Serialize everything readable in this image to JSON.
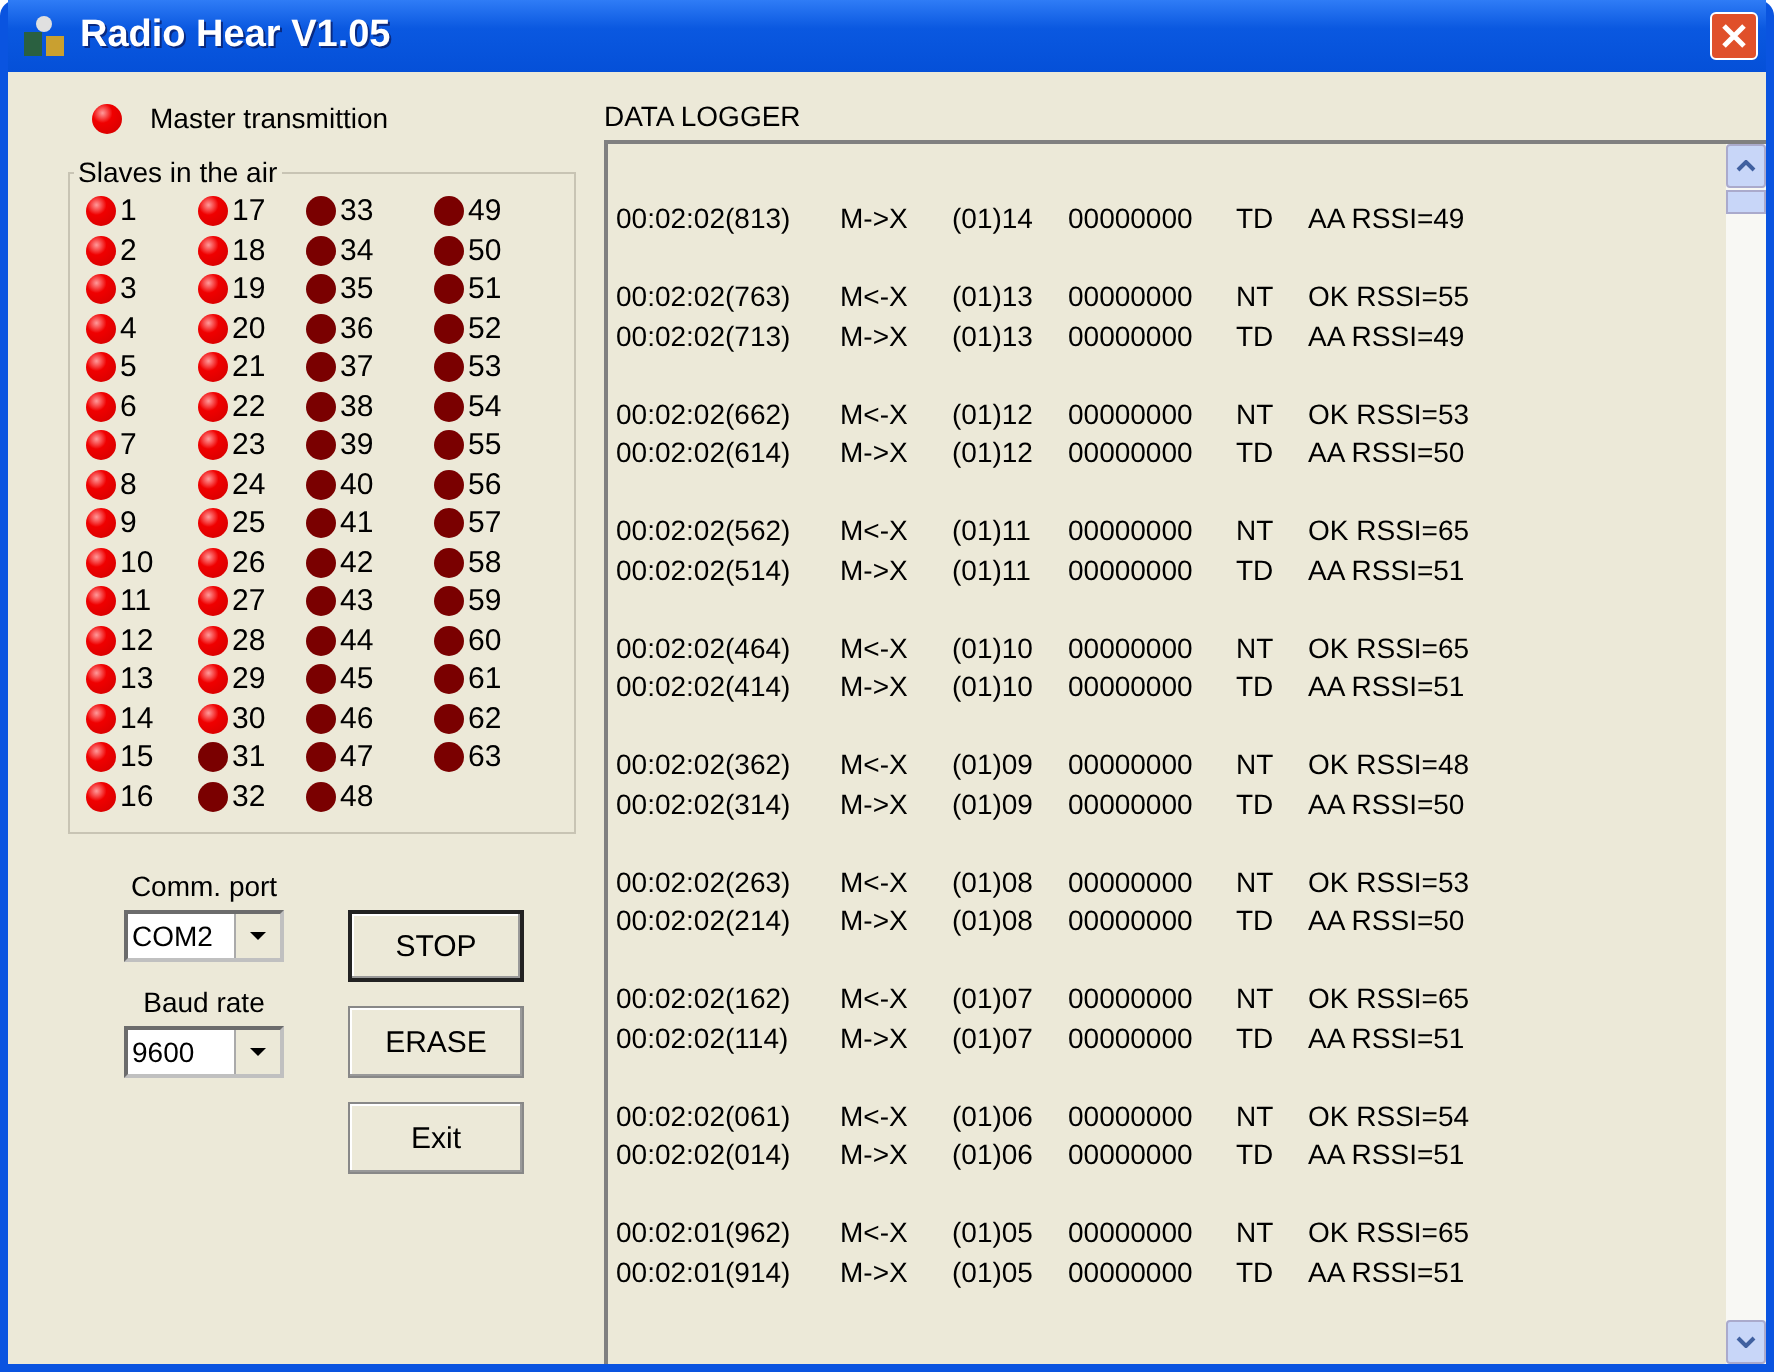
{
  "window": {
    "title": "Radio Hear V1.05"
  },
  "master": {
    "label": "Master transmittion",
    "on": true
  },
  "slaves": {
    "title": "Slaves in the air",
    "items": [
      {
        "label": "1",
        "on": true
      },
      {
        "label": "2",
        "on": true
      },
      {
        "label": "3",
        "on": true
      },
      {
        "label": "4",
        "on": true
      },
      {
        "label": "5",
        "on": true
      },
      {
        "label": "6",
        "on": true
      },
      {
        "label": "7",
        "on": true
      },
      {
        "label": "8",
        "on": true
      },
      {
        "label": "9",
        "on": true
      },
      {
        "label": "10",
        "on": true
      },
      {
        "label": "11",
        "on": true
      },
      {
        "label": "12",
        "on": true
      },
      {
        "label": "13",
        "on": true
      },
      {
        "label": "14",
        "on": true
      },
      {
        "label": "15",
        "on": true
      },
      {
        "label": "16",
        "on": true
      },
      {
        "label": "17",
        "on": true
      },
      {
        "label": "18",
        "on": true
      },
      {
        "label": "19",
        "on": true
      },
      {
        "label": "20",
        "on": true
      },
      {
        "label": "21",
        "on": true
      },
      {
        "label": "22",
        "on": true
      },
      {
        "label": "23",
        "on": true
      },
      {
        "label": "24",
        "on": true
      },
      {
        "label": "25",
        "on": true
      },
      {
        "label": "26",
        "on": true
      },
      {
        "label": "27",
        "on": true
      },
      {
        "label": "28",
        "on": true
      },
      {
        "label": "29",
        "on": true
      },
      {
        "label": "30",
        "on": true
      },
      {
        "label": "31",
        "on": false
      },
      {
        "label": "32",
        "on": false
      },
      {
        "label": "33",
        "on": false
      },
      {
        "label": "34",
        "on": false
      },
      {
        "label": "35",
        "on": false
      },
      {
        "label": "36",
        "on": false
      },
      {
        "label": "37",
        "on": false
      },
      {
        "label": "38",
        "on": false
      },
      {
        "label": "39",
        "on": false
      },
      {
        "label": "40",
        "on": false
      },
      {
        "label": "41",
        "on": false
      },
      {
        "label": "42",
        "on": false
      },
      {
        "label": "43",
        "on": false
      },
      {
        "label": "44",
        "on": false
      },
      {
        "label": "45",
        "on": false
      },
      {
        "label": "46",
        "on": false
      },
      {
        "label": "47",
        "on": false
      },
      {
        "label": "48",
        "on": false
      },
      {
        "label": "49",
        "on": false
      },
      {
        "label": "50",
        "on": false
      },
      {
        "label": "51",
        "on": false
      },
      {
        "label": "52",
        "on": false
      },
      {
        "label": "53",
        "on": false
      },
      {
        "label": "54",
        "on": false
      },
      {
        "label": "55",
        "on": false
      },
      {
        "label": "56",
        "on": false
      },
      {
        "label": "57",
        "on": false
      },
      {
        "label": "58",
        "on": false
      },
      {
        "label": "59",
        "on": false
      },
      {
        "label": "60",
        "on": false
      },
      {
        "label": "61",
        "on": false
      },
      {
        "label": "62",
        "on": false
      },
      {
        "label": "63",
        "on": false
      }
    ]
  },
  "comm_port": {
    "label": "Comm. port",
    "value": "COM2"
  },
  "baud_rate": {
    "label": "Baud rate",
    "value": "9600"
  },
  "buttons": [
    {
      "label": "STOP",
      "default": true
    },
    {
      "label": "ERASE",
      "default": false
    },
    {
      "label": "Exit",
      "default": false
    }
  ],
  "log": {
    "title": "DATA LOGGER",
    "groups": [
      [
        [
          "00:02:02(813)",
          "M->X",
          "(01)14",
          "00000000",
          "TD",
          "AA RSSI=49"
        ]
      ],
      [
        [
          "00:02:02(763)",
          "M<-X",
          "(01)13",
          "00000000",
          "NT",
          "OK RSSI=55"
        ],
        [
          "00:02:02(713)",
          "M->X",
          "(01)13",
          "00000000",
          "TD",
          "AA RSSI=49"
        ]
      ],
      [
        [
          "00:02:02(662)",
          "M<-X",
          "(01)12",
          "00000000",
          "NT",
          "OK RSSI=53"
        ],
        [
          "00:02:02(614)",
          "M->X",
          "(01)12",
          "00000000",
          "TD",
          "AA RSSI=50"
        ]
      ],
      [
        [
          "00:02:02(562)",
          "M<-X",
          "(01)11",
          "00000000",
          "NT",
          "OK RSSI=65"
        ],
        [
          "00:02:02(514)",
          "M->X",
          "(01)11",
          "00000000",
          "TD",
          "AA RSSI=51"
        ]
      ],
      [
        [
          "00:02:02(464)",
          "M<-X",
          "(01)10",
          "00000000",
          "NT",
          "OK RSSI=65"
        ],
        [
          "00:02:02(414)",
          "M->X",
          "(01)10",
          "00000000",
          "TD",
          "AA RSSI=51"
        ]
      ],
      [
        [
          "00:02:02(362)",
          "M<-X",
          "(01)09",
          "00000000",
          "NT",
          "OK RSSI=48"
        ],
        [
          "00:02:02(314)",
          "M->X",
          "(01)09",
          "00000000",
          "TD",
          "AA RSSI=50"
        ]
      ],
      [
        [
          "00:02:02(263)",
          "M<-X",
          "(01)08",
          "00000000",
          "NT",
          "OK RSSI=53"
        ],
        [
          "00:02:02(214)",
          "M->X",
          "(01)08",
          "00000000",
          "TD",
          "AA RSSI=50"
        ]
      ],
      [
        [
          "00:02:02(162)",
          "M<-X",
          "(01)07",
          "00000000",
          "NT",
          "OK RSSI=65"
        ],
        [
          "00:02:02(114)",
          "M->X",
          "(01)07",
          "00000000",
          "TD",
          "AA RSSI=51"
        ]
      ],
      [
        [
          "00:02:02(061)",
          "M<-X",
          "(01)06",
          "00000000",
          "NT",
          "OK RSSI=54"
        ],
        [
          "00:02:02(014)",
          "M->X",
          "(01)06",
          "00000000",
          "TD",
          "AA RSSI=51"
        ]
      ],
      [
        [
          "00:02:01(962)",
          "M<-X",
          "(01)05",
          "00000000",
          "NT",
          "OK RSSI=65"
        ],
        [
          "00:02:01(914)",
          "M->X",
          "(01)05",
          "00000000",
          "TD",
          "AA RSSI=51"
        ]
      ]
    ]
  }
}
